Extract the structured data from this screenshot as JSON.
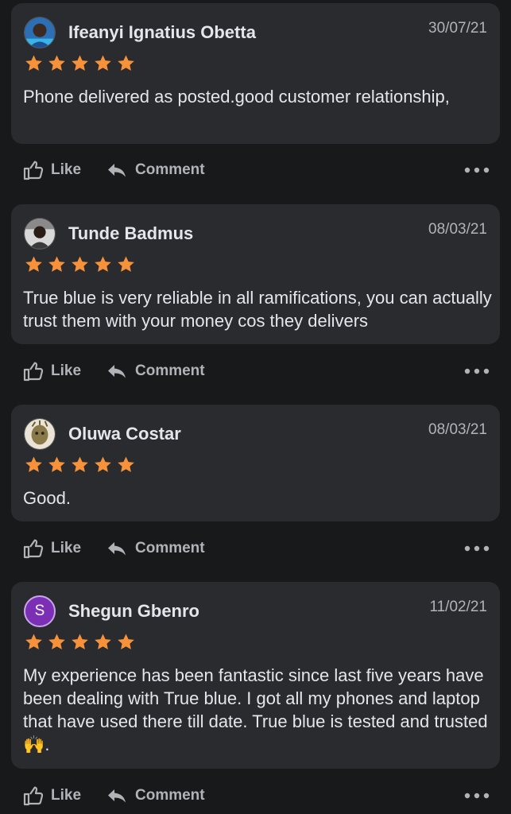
{
  "actions": {
    "like_label": "Like",
    "comment_label": "Comment"
  },
  "reviews": [
    {
      "name": "Ifeanyi Ignatius Obetta",
      "date": "30/07/21",
      "rating": 5,
      "text": "Phone delivered as posted.good customer relationship,",
      "avatar": "photo"
    },
    {
      "name": "Tunde Badmus",
      "date": "08/03/21",
      "rating": 5,
      "text": "True blue is very reliable in all ramifications, you can actually trust them with your money cos they delivers",
      "avatar": "photo"
    },
    {
      "name": "Oluwa Costar",
      "date": "08/03/21",
      "rating": 5,
      "text": "Good.",
      "avatar": "photo"
    },
    {
      "name": "Shegun Gbenro",
      "date": "11/02/21",
      "rating": 5,
      "text": "My experience has been fantastic since last five years have been dealing with True blue. I got all my phones and laptop that have used there till date. True blue is tested and trusted🙌.",
      "avatar_letter": "S"
    }
  ],
  "colors": {
    "background": "#18191a",
    "card": "#2a2b2e",
    "star": "#f7923a",
    "muted_text": "#b0b3b8",
    "letter_avatar": "#7b2fb5"
  },
  "icons": [
    "thumbs-up-icon",
    "reply-arrow-icon",
    "more-dots-icon",
    "star-icon"
  ]
}
